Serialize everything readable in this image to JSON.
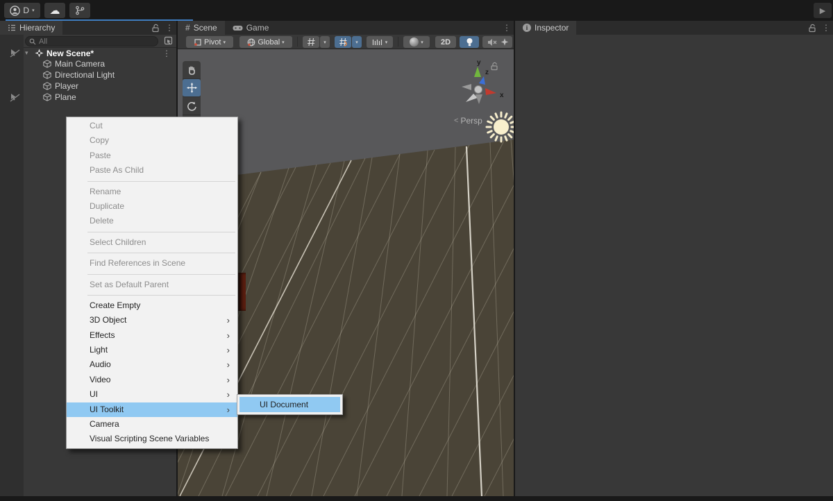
{
  "colors": {
    "accent_blue": "#4c6e91",
    "menu_highlight": "#90c9f2",
    "panel": "#383838",
    "sky": "#58585a",
    "ground": "#4a4437"
  },
  "icons": {
    "kebab": "⋮",
    "dropdown": "▾",
    "play": "▶",
    "cloud": "☁",
    "plus": "+",
    "hash": "#",
    "chevron_right": "›",
    "persp_arrow": "<"
  },
  "topbar": {
    "account_label": "D"
  },
  "hierarchy": {
    "tab_label": "Hierarchy",
    "search_placeholder": "All",
    "scene_name": "New Scene*",
    "items": [
      {
        "label": "Main Camera"
      },
      {
        "label": "Directional Light"
      },
      {
        "label": "Player"
      },
      {
        "label": "Plane"
      }
    ]
  },
  "scene_view": {
    "tab_scene": "Scene",
    "tab_game": "Game",
    "toolbar": {
      "pivot_label": "Pivot",
      "global_label": "Global",
      "label_2d": "2D"
    },
    "gizmo": {
      "x": "x",
      "y": "y",
      "z": "z",
      "persp": "Persp"
    }
  },
  "inspector": {
    "tab_label": "Inspector"
  },
  "context_menu": {
    "items": [
      {
        "label": "Cut"
      },
      {
        "label": "Copy"
      },
      {
        "label": "Paste"
      },
      {
        "label": "Paste As Child"
      },
      {
        "label": "Rename"
      },
      {
        "label": "Duplicate"
      },
      {
        "label": "Delete"
      },
      {
        "label": "Select Children"
      },
      {
        "label": "Find References in Scene"
      },
      {
        "label": "Set as Default Parent"
      },
      {
        "label": "Create Empty"
      },
      {
        "label": "3D Object"
      },
      {
        "label": "Effects"
      },
      {
        "label": "Light"
      },
      {
        "label": "Audio"
      },
      {
        "label": "Video"
      },
      {
        "label": "UI"
      },
      {
        "label": "UI Toolkit"
      },
      {
        "label": "Camera"
      },
      {
        "label": "Visual Scripting Scene Variables"
      }
    ]
  },
  "submenu": {
    "items": [
      {
        "label": "UI Document"
      }
    ]
  }
}
